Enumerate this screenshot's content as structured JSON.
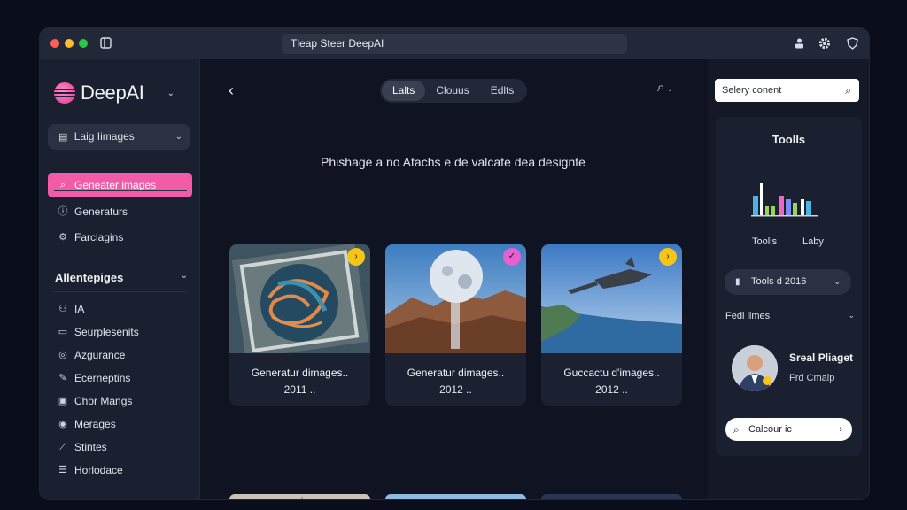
{
  "window": {
    "address": "Tleap Steer DeepAI"
  },
  "brand": {
    "name": "DeepAI"
  },
  "sidebar": {
    "select_label": "Laig Iimages",
    "items": [
      {
        "label": "Geneater images",
        "icon": "search-icon"
      },
      {
        "label": "Generaturs",
        "icon": "info-icon"
      },
      {
        "label": "Farclagins",
        "icon": "gear-icon"
      }
    ],
    "section_title": "Allentepiges",
    "section_items": [
      {
        "label": "IA",
        "icon": "people-icon"
      },
      {
        "label": "Seurplesenits",
        "icon": "calendar-icon"
      },
      {
        "label": "Azgurance",
        "icon": "globe-icon"
      },
      {
        "label": "Ecerneptins",
        "icon": "edit-icon"
      },
      {
        "label": "Chor Mangs",
        "icon": "chat-icon"
      },
      {
        "label": "Merages",
        "icon": "message-icon"
      },
      {
        "label": "Stintes",
        "icon": "pen-icon"
      },
      {
        "label": "Horlodace",
        "icon": "list-icon"
      }
    ]
  },
  "main": {
    "tabs": [
      "Lalts",
      "Clouus",
      "Edlts"
    ],
    "active_tab": 0,
    "heading": "Phishage a no Atachs e de valcate dea designte",
    "cards": [
      {
        "title": "Generatur dimages..",
        "subtitle": "2011 ..",
        "badge": "›",
        "badge_color": "#f5c518"
      },
      {
        "title": "Generatur dimages..",
        "subtitle": "2012 ..",
        "badge": "✓",
        "badge_color": "#e85fd0"
      },
      {
        "title": "Guccactu d'images..",
        "subtitle": "2012 ..",
        "badge": "›",
        "badge_color": "#f5c518"
      }
    ]
  },
  "right": {
    "search_placeholder": "Selery conent",
    "tools_title": "Toolls",
    "tools_labels": [
      "Toolis",
      "Laby"
    ],
    "select_label": "Tools d 2016",
    "row_label": "Fedl limes",
    "profile_name": "Sreal Pliaget",
    "profile_role": "Frd Cmaip",
    "cta_label": "Calcour ic"
  },
  "colors": {
    "accent": "#f25ba8",
    "background": "#0f1322",
    "sidebar": "#1b2030"
  }
}
